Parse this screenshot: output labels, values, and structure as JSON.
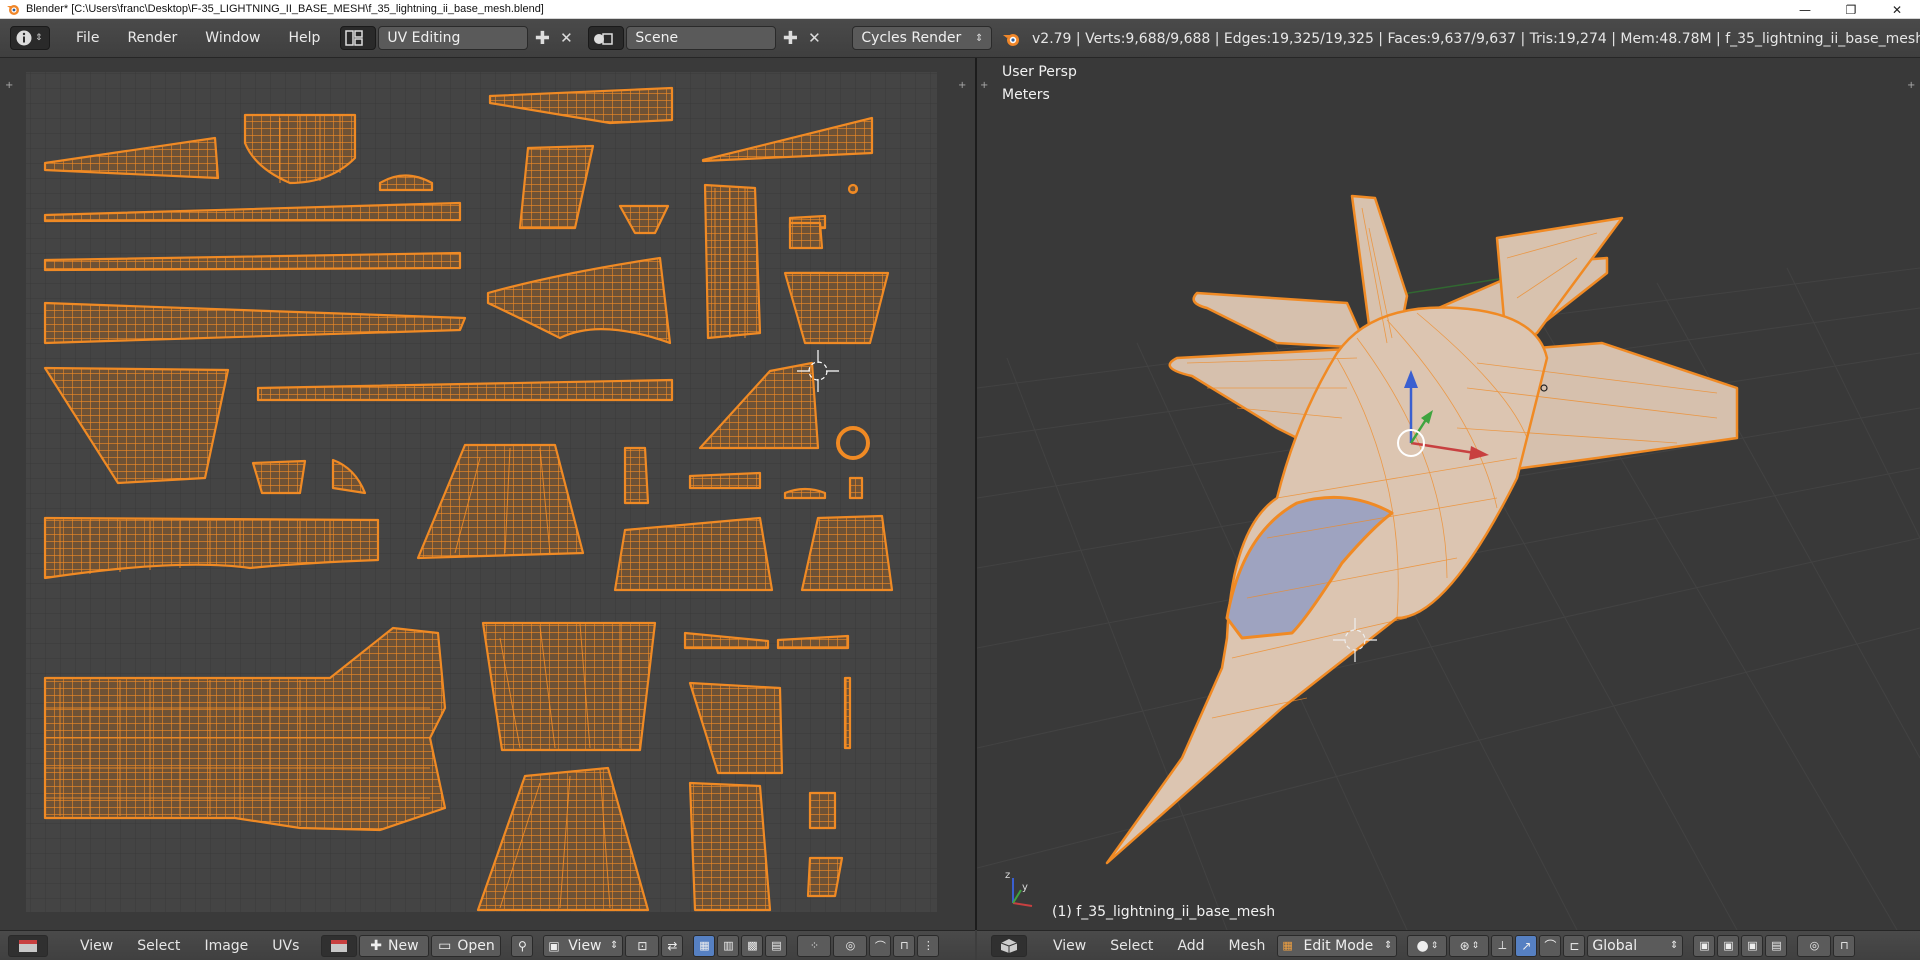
{
  "window": {
    "title": "Blender* [C:\\Users\\franc\\Desktop\\F-35_LIGHTNING_II_BASE_MESH\\f_35_lightning_ii_base_mesh.blend]",
    "minimize": "—",
    "maximize": "❐",
    "close": "✕"
  },
  "infobar": {
    "menus": [
      "File",
      "Render",
      "Window",
      "Help"
    ],
    "screen_layout": "UV Editing",
    "scene": "Scene",
    "render_engine": "Cycles Render",
    "stats": "v2.79 | Verts:9,688/9,688 | Edges:19,325/19,325 | Faces:9,637/9,637 | Tris:19,274 | Mem:48.78M | f_35_lightning_ii_base_mesh"
  },
  "viewport": {
    "view_name": "User Persp",
    "units": "Meters",
    "object_label": "(1) f_35_lightning_ii_base_mesh"
  },
  "uv_bottombar": {
    "menus": [
      "View",
      "Select",
      "Image",
      "UVs"
    ],
    "new_label": "New",
    "open_label": "Open",
    "view_label": "View"
  },
  "view3d_bottombar": {
    "menus": [
      "View",
      "Select",
      "Add",
      "Mesh"
    ],
    "mode": "Edit Mode",
    "orientation": "Global"
  },
  "colors": {
    "accent_orange": "#f08a24",
    "uv_fill": "#7a5a3a",
    "grid_bg": "#444444",
    "axis_red": "#c84040",
    "axis_green": "#3fa43f",
    "axis_blue": "#3a5fd0"
  }
}
